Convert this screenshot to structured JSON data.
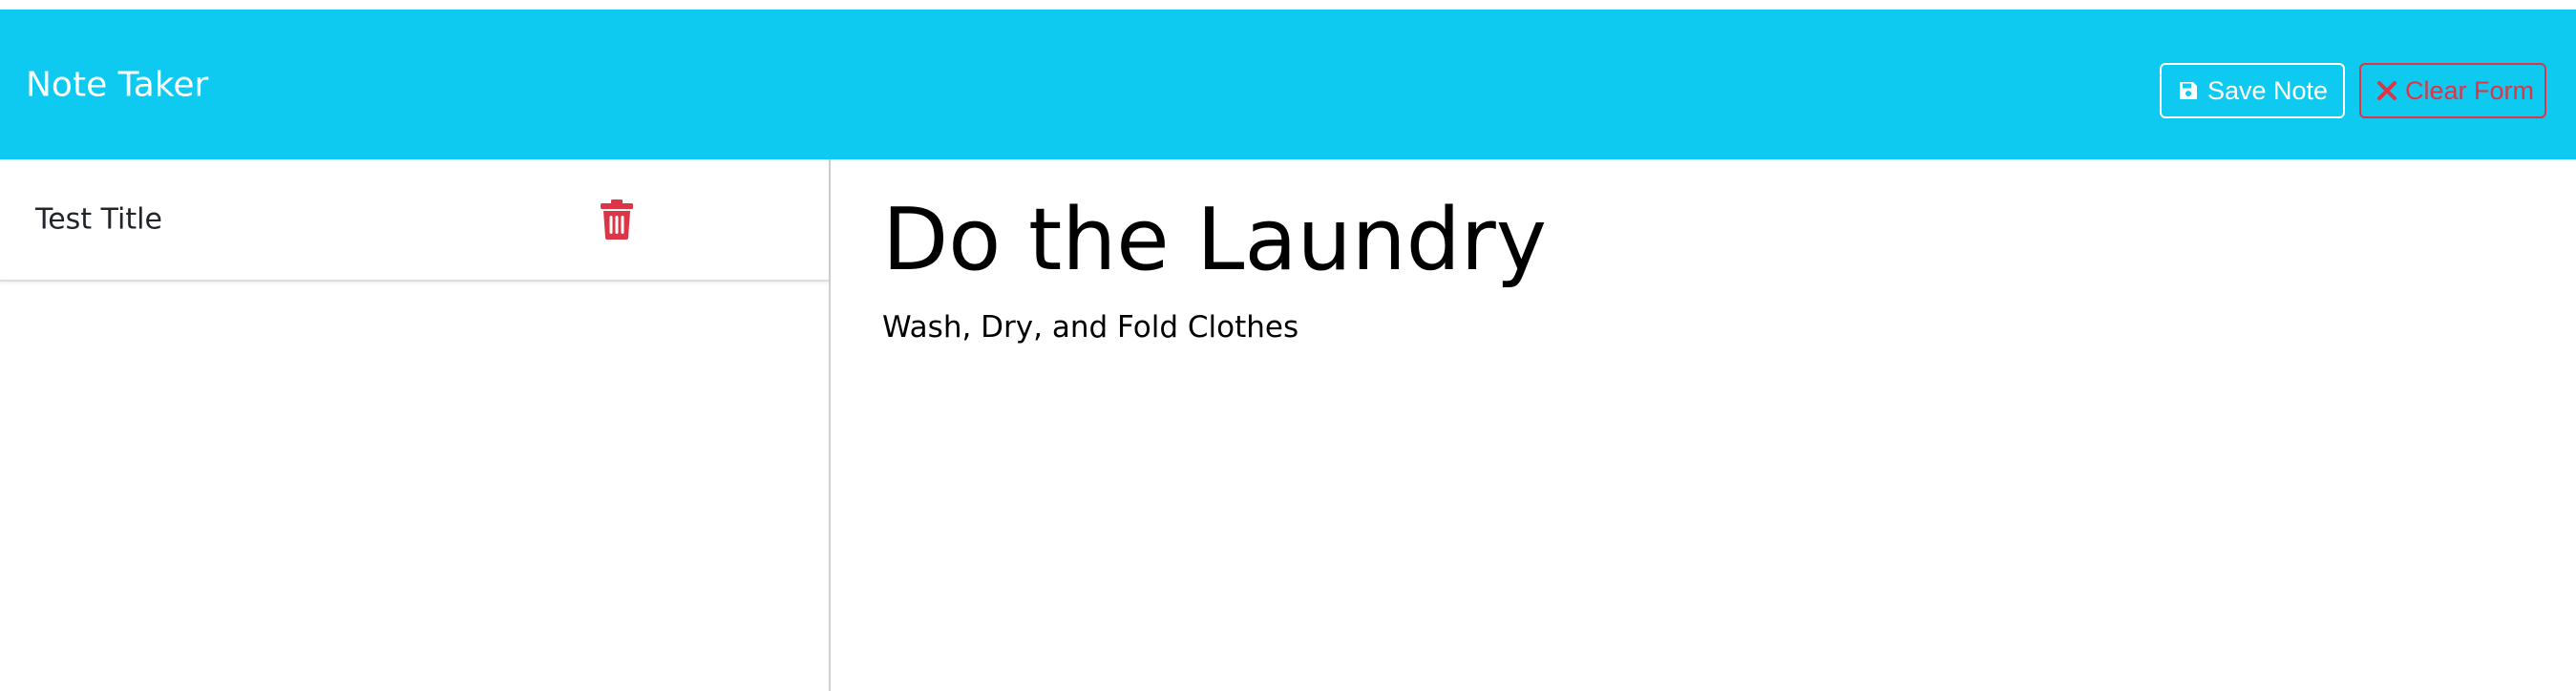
{
  "header": {
    "brand": "Note Taker",
    "save_label": "Save Note",
    "clear_label": "Clear Form"
  },
  "sidebar": {
    "notes": [
      {
        "title": "Test Title"
      }
    ]
  },
  "editor": {
    "title": "Do the Laundry",
    "text": "Wash, Dry, and Fold Clothes"
  },
  "colors": {
    "navbar": "#0fcaf0",
    "danger": "#dc3545",
    "white": "#ffffff"
  },
  "icons": {
    "save": "floppy-disk-icon",
    "clear": "x-mark-icon",
    "delete": "trash-icon"
  }
}
